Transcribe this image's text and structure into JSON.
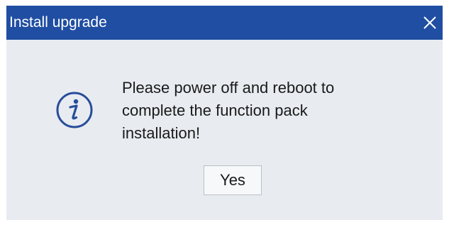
{
  "dialog": {
    "title": "Install upgrade",
    "message_lines": [
      "Please power off and reboot to",
      "complete the function pack",
      "installation!"
    ],
    "yes_label": "Yes"
  },
  "icons": {
    "close": "close-icon",
    "info": "info-icon"
  },
  "colors": {
    "titlebar": "#1f4ea2",
    "body": "#e8ebf0",
    "icon": "#264d9a"
  }
}
